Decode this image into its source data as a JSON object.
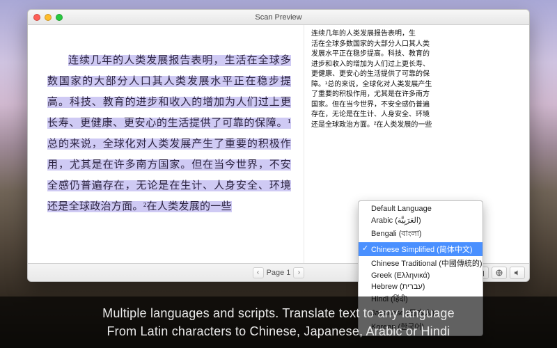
{
  "window": {
    "title": "Scan Preview"
  },
  "preview": {
    "body": "连续几年的人类发展报告表明，生活在全球多数国家的大部分人口其人类发展水平正在稳步提高。科技、教育的进步和收入的增加为人们过上更长寿、更健康、更安心的生活提供了可靠的保障。¹总的来说，全球化对人类发展产生了重要的积极作用，尤其是在许多南方国家。但在当今世界，不安全感仍普遍存在，无论是在生计、人身安全、环境还是全球政治方面。²在人类发展的一些"
  },
  "ocr": {
    "lines": [
      "连续几年的人类发展报告表明，生",
      "活在全球多数国家的大部分人口其人类",
      "发展水平正在稳步提高。科技、教育的",
      "进步和收入的增加为人们过上更长寿、",
      "更健康、更安心的生活提供了可靠的保",
      "障。¹总的来说，全球化对人类发展产生",
      "了重要的积极作用，尤其是在许多南方",
      "国家。但在当今世界，不安全感仍普遍",
      "存在，无论是在生计、人身安全、环境",
      "还是全球政治方面。²在人类发展的一些"
    ]
  },
  "footer": {
    "page_label": "Page 1"
  },
  "language_menu": {
    "items": [
      "Default Language",
      "Arabic (العَرَبِيَّة)",
      "Bengali (বাংলা)",
      "Chinese Simplified (简体中文)",
      "Chinese Traditional (中國傳統的)",
      "Greek (Ελληνικά)",
      "Hebrew (עברית)",
      "Hindi (हिंदी)",
      "Japanese (日本人)",
      "Korean (한국어)"
    ],
    "selected_index": 3
  },
  "caption": {
    "line1": "Multiple languages and scripts. Translate text to any language",
    "line2": "From Latin characters to Chinese, Japanese, Arabic or Hindi"
  },
  "icons": {
    "prev": "‹",
    "next": "›"
  }
}
